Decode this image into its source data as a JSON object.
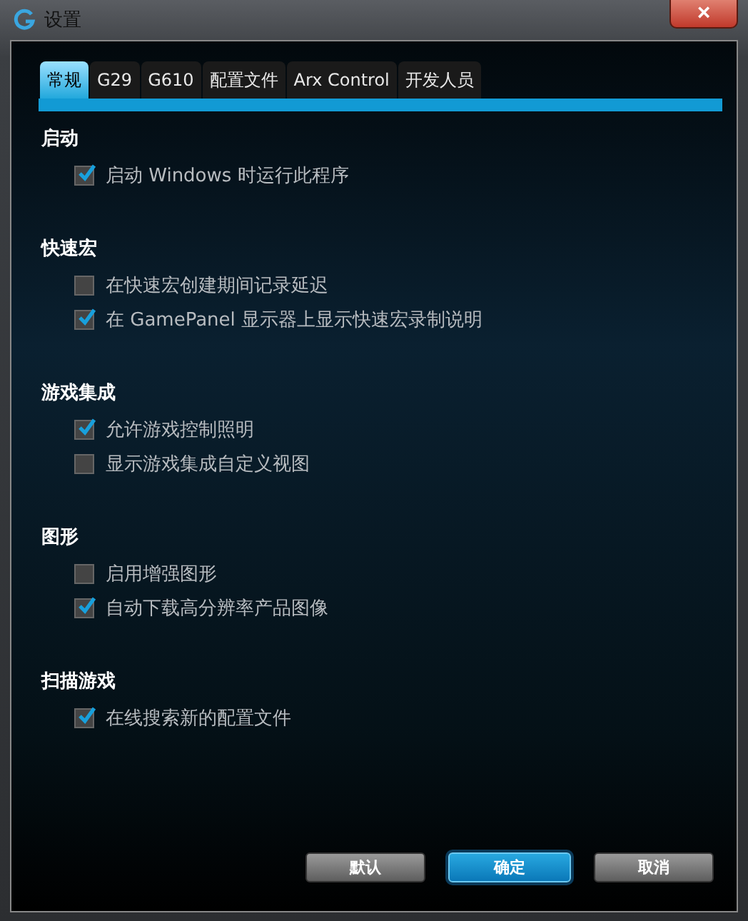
{
  "window": {
    "title": "设置",
    "close": "×"
  },
  "tabs": [
    {
      "label": "常规",
      "selected": true
    },
    {
      "label": "G29",
      "selected": false
    },
    {
      "label": "G610",
      "selected": false
    },
    {
      "label": "配置文件",
      "selected": false
    },
    {
      "label": "Arx Control",
      "selected": false
    },
    {
      "label": "开发人员",
      "selected": false
    }
  ],
  "sections": [
    {
      "title": "启动",
      "options": [
        {
          "label": "启动 Windows 时运行此程序",
          "checked": true
        }
      ]
    },
    {
      "title": "快速宏",
      "options": [
        {
          "label": "在快速宏创建期间记录延迟",
          "checked": false
        },
        {
          "label": "在 GamePanel 显示器上显示快速宏录制说明",
          "checked": true
        }
      ]
    },
    {
      "title": "游戏集成",
      "options": [
        {
          "label": "允许游戏控制照明",
          "checked": true
        },
        {
          "label": "显示游戏集成自定义视图",
          "checked": false
        }
      ]
    },
    {
      "title": "图形",
      "options": [
        {
          "label": "启用增强图形",
          "checked": false
        },
        {
          "label": "自动下载高分辨率产品图像",
          "checked": true
        }
      ]
    },
    {
      "title": "扫描游戏",
      "options": [
        {
          "label": "在线搜索新的配置文件",
          "checked": true
        }
      ]
    }
  ],
  "buttons": [
    {
      "label": "默认",
      "kind": "secondary"
    },
    {
      "label": "确定",
      "kind": "primary"
    },
    {
      "label": "取消",
      "kind": "secondary"
    }
  ]
}
